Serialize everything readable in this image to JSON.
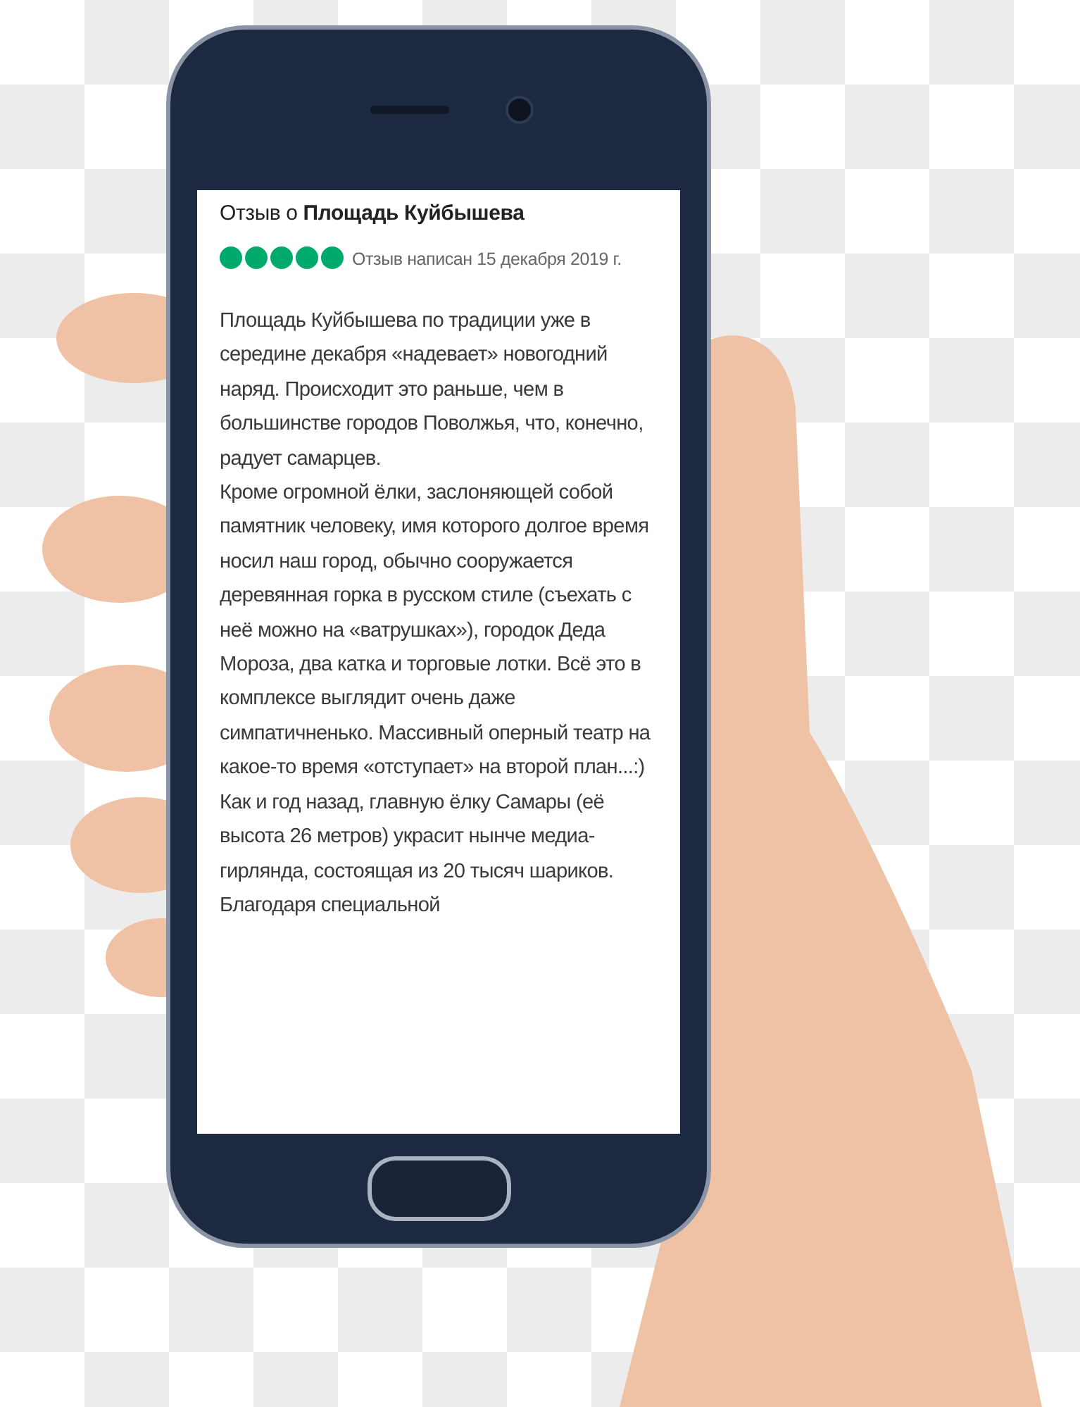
{
  "review": {
    "title": "Отзыв о **Площадь Куйбышева**",
    "stars": 5,
    "date": "Отзыв написан 15 декабря 2019 г.",
    "paragraphs": [
      "Площадь Куйбышева по традиции уже в середине декабря «надевает» новогодний наряд. Происходит это раньше, чем в большинстве городов Поволжья, что, конечно, радует самарцев.",
      "Кроме огромной ёлки, заслоняющей собой памятник человеку, имя которого долгое время носил наш город, обычно сооружается деревянная горка в русском стиле (съехать с неё можно на «ватрушках»), городок Деда Мороза, два катка и торговые лотки. Всё это в комплексе выглядит очень даже симпатичненько. Массивный оперный театр на какое-то время «отступает» на второй план...:)",
      "Как и год назад, главную ёлку Самары (её высота 26 метров) украсит нынче медиа-гирлянда, состоящая из 20 тысяч шариков. Благодаря специальной"
    ]
  }
}
